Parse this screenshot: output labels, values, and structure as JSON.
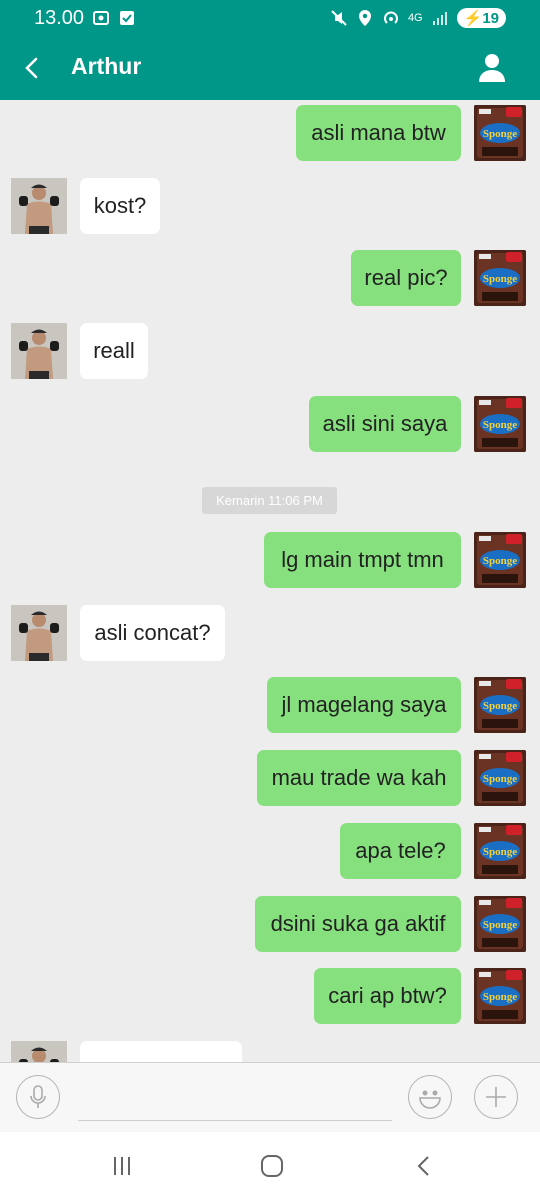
{
  "status_bar": {
    "time": "13.00",
    "network": "4G",
    "battery": "19"
  },
  "header": {
    "title": "Arthur",
    "back_icon": "chevron-left-icon",
    "profile_icon": "person-icon"
  },
  "messages": [
    {
      "dir": "out",
      "text": "asli mana btw"
    },
    {
      "dir": "in",
      "text": "kost?"
    },
    {
      "dir": "out",
      "text": "real pic?"
    },
    {
      "dir": "in",
      "text": "reall"
    },
    {
      "dir": "out",
      "text": "asli sini saya"
    },
    {
      "dir": "divider",
      "text": "Kemarin 11:06 PM"
    },
    {
      "dir": "out",
      "text": "lg main tmpt tmn"
    },
    {
      "dir": "in",
      "text": "asli concat?"
    },
    {
      "dir": "out",
      "text": "jl magelang saya"
    },
    {
      "dir": "out",
      "text": "mau trade wa kah"
    },
    {
      "dir": "out",
      "text": "apa tele?"
    },
    {
      "dir": "out",
      "text": "dsini suka ga aktif"
    },
    {
      "dir": "out",
      "text": "cari ap btw?"
    },
    {
      "dir": "in",
      "text": ""
    }
  ],
  "input_bar": {
    "mic_icon": "microphone-icon",
    "emoji_icon": "smiley-icon",
    "plus_icon": "plus-icon",
    "placeholder": ""
  },
  "nav_bar": {
    "recents_icon": "recents-icon",
    "home_icon": "home-icon",
    "back_icon": "back-icon"
  },
  "colors": {
    "primary": "#009688",
    "outgoing_bubble": "#86e07e",
    "incoming_bubble": "#ffffff",
    "chat_background": "#ededed"
  }
}
